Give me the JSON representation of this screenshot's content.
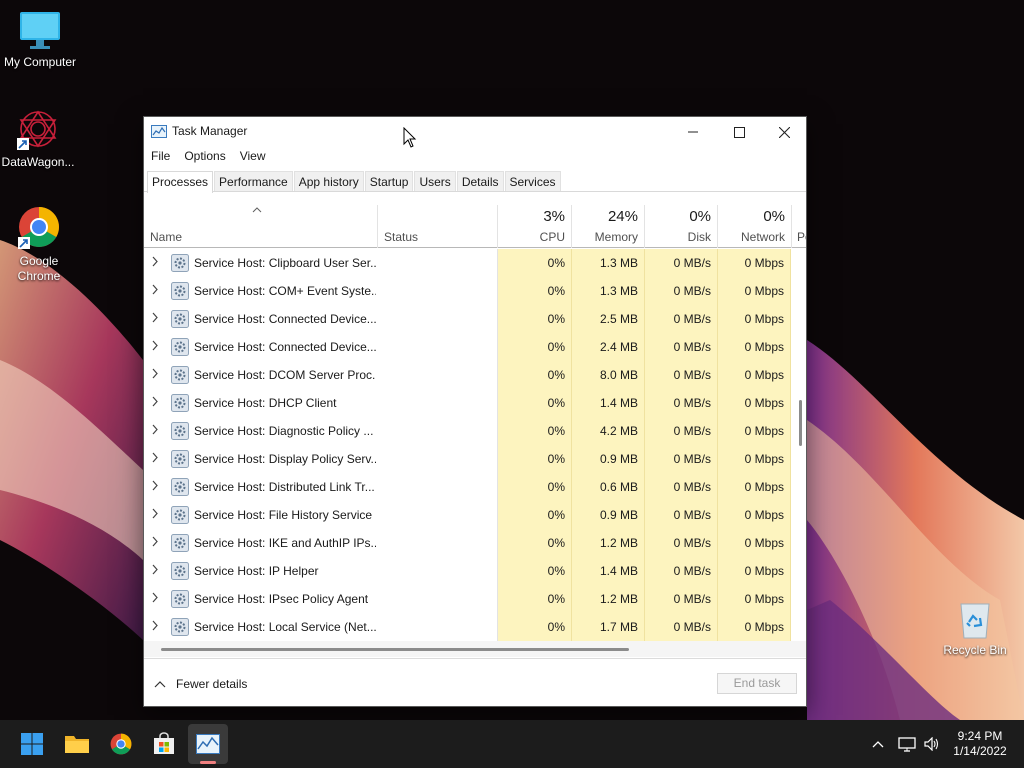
{
  "desktop": {
    "icons": [
      {
        "label": "My Computer"
      },
      {
        "label": "DataWagon..."
      },
      {
        "label": "Google Chrome"
      },
      {
        "label": "Recycle Bin"
      }
    ]
  },
  "window": {
    "title": "Task Manager",
    "menu": [
      "File",
      "Options",
      "View"
    ],
    "tabs": [
      "Processes",
      "Performance",
      "App history",
      "Startup",
      "Users",
      "Details",
      "Services"
    ],
    "active_tab": "Processes"
  },
  "columns": {
    "name": "Name",
    "status": "Status",
    "cpu": {
      "pct": "3%",
      "label": "CPU"
    },
    "memory": {
      "pct": "24%",
      "label": "Memory"
    },
    "disk": {
      "pct": "0%",
      "label": "Disk"
    },
    "network": {
      "pct": "0%",
      "label": "Network"
    },
    "power": "Po"
  },
  "processes": [
    {
      "name": "Service Host: Clipboard User Ser...",
      "cpu": "0%",
      "memory": "1.3 MB",
      "disk": "0 MB/s",
      "network": "0 Mbps"
    },
    {
      "name": "Service Host: COM+ Event Syste...",
      "cpu": "0%",
      "memory": "1.3 MB",
      "disk": "0 MB/s",
      "network": "0 Mbps"
    },
    {
      "name": "Service Host: Connected Device...",
      "cpu": "0%",
      "memory": "2.5 MB",
      "disk": "0 MB/s",
      "network": "0 Mbps"
    },
    {
      "name": "Service Host: Connected Device...",
      "cpu": "0%",
      "memory": "2.4 MB",
      "disk": "0 MB/s",
      "network": "0 Mbps"
    },
    {
      "name": "Service Host: DCOM Server Proc...",
      "cpu": "0%",
      "memory": "8.0 MB",
      "disk": "0 MB/s",
      "network": "0 Mbps"
    },
    {
      "name": "Service Host: DHCP Client",
      "cpu": "0%",
      "memory": "1.4 MB",
      "disk": "0 MB/s",
      "network": "0 Mbps"
    },
    {
      "name": "Service Host: Diagnostic Policy ...",
      "cpu": "0%",
      "memory": "4.2 MB",
      "disk": "0 MB/s",
      "network": "0 Mbps"
    },
    {
      "name": "Service Host: Display Policy Serv...",
      "cpu": "0%",
      "memory": "0.9 MB",
      "disk": "0 MB/s",
      "network": "0 Mbps"
    },
    {
      "name": "Service Host: Distributed Link Tr...",
      "cpu": "0%",
      "memory": "0.6 MB",
      "disk": "0 MB/s",
      "network": "0 Mbps"
    },
    {
      "name": "Service Host: File History Service",
      "cpu": "0%",
      "memory": "0.9 MB",
      "disk": "0 MB/s",
      "network": "0 Mbps"
    },
    {
      "name": "Service Host: IKE and AuthIP IPs...",
      "cpu": "0%",
      "memory": "1.2 MB",
      "disk": "0 MB/s",
      "network": "0 Mbps"
    },
    {
      "name": "Service Host: IP Helper",
      "cpu": "0%",
      "memory": "1.4 MB",
      "disk": "0 MB/s",
      "network": "0 Mbps"
    },
    {
      "name": "Service Host: IPsec Policy Agent",
      "cpu": "0%",
      "memory": "1.2 MB",
      "disk": "0 MB/s",
      "network": "0 Mbps"
    },
    {
      "name": "Service Host: Local Service (Net...",
      "cpu": "0%",
      "memory": "1.7 MB",
      "disk": "0 MB/s",
      "network": "0 Mbps"
    }
  ],
  "footer": {
    "fewer_details": "Fewer details",
    "end_task": "End task"
  },
  "taskbar": {
    "apps": [
      "start-icon",
      "file-explorer-icon",
      "chrome-icon",
      "store-icon",
      "task-manager-icon"
    ],
    "time": "9:24 PM",
    "date": "1/14/2022"
  },
  "colors": {
    "heat_cell": "#fdf4bf",
    "taskbar": "#1c1c1c",
    "desktop_bg": "#0c0709"
  }
}
